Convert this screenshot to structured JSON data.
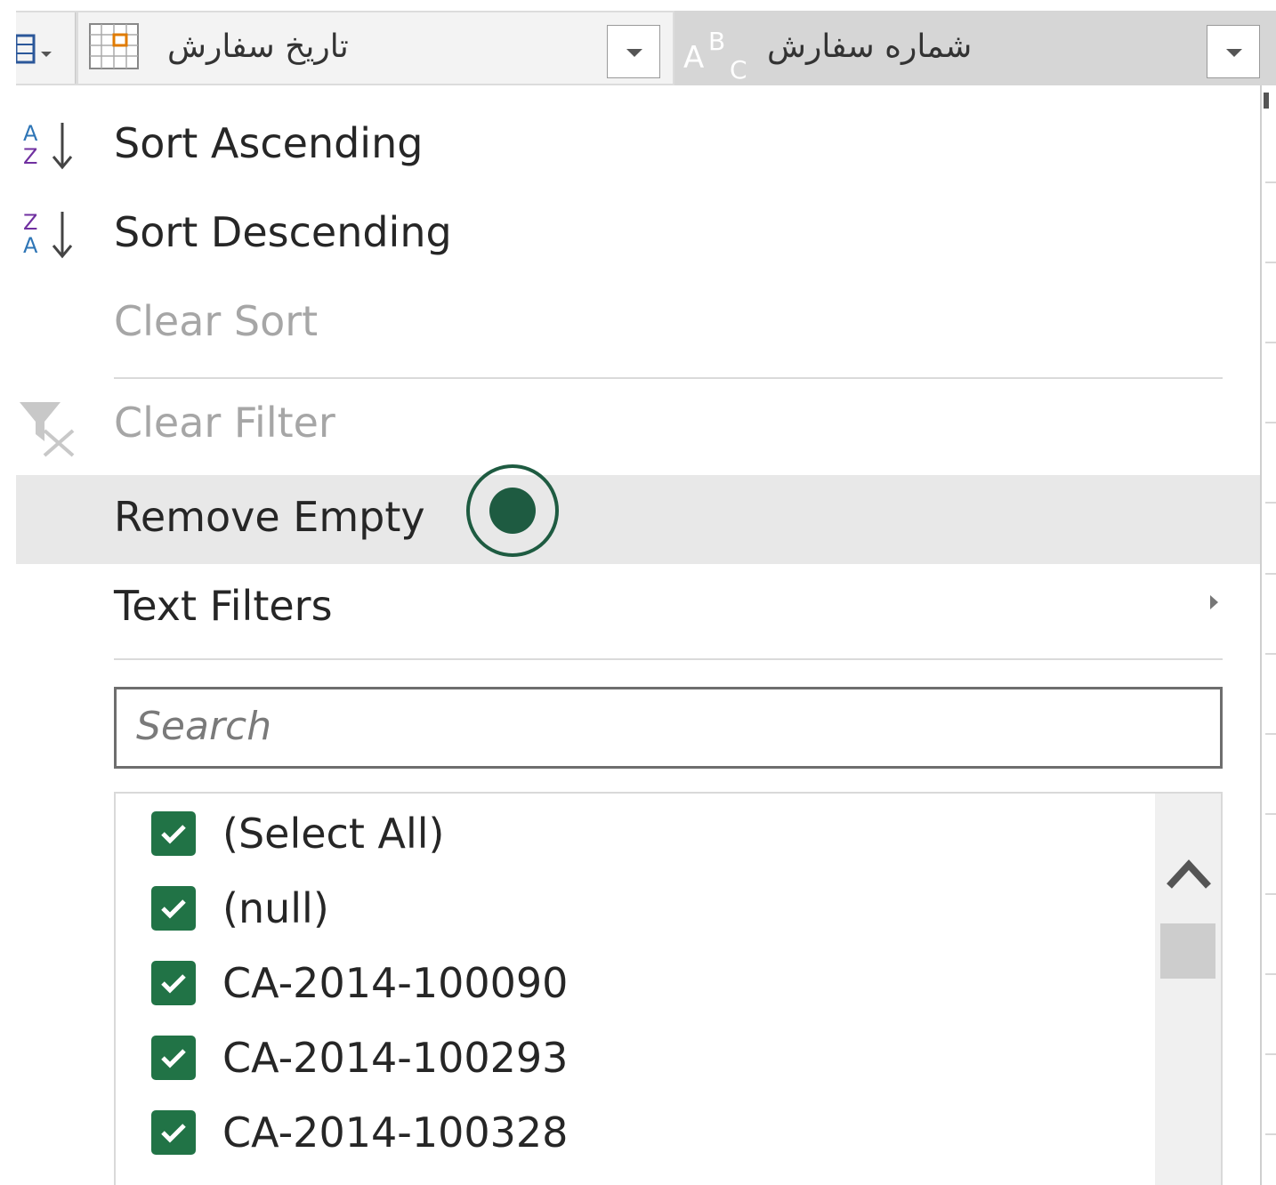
{
  "header": {
    "date_column": {
      "title": "تاریخ سفارش",
      "type_icon": "calendar-table-icon",
      "dropdown_icon": "chevron-down-icon"
    },
    "order_column": {
      "title": "شماره سفارش",
      "type_icon": "text-abc-icon",
      "dropdown_icon": "chevron-down-icon"
    },
    "prev_column": {
      "type_icon": "table-icon"
    }
  },
  "menu": {
    "sort_ascending": "Sort Ascending",
    "sort_descending": "Sort Descending",
    "clear_sort": "Clear Sort",
    "clear_filter": "Clear Filter",
    "remove_empty": "Remove Empty",
    "text_filters": "Text Filters"
  },
  "search": {
    "placeholder": "Search"
  },
  "filter_list": {
    "items": [
      {
        "label": "(Select All)",
        "checked": true
      },
      {
        "label": "(null)",
        "checked": true
      },
      {
        "label": "CA-2014-100090",
        "checked": true
      },
      {
        "label": "CA-2014-100293",
        "checked": true
      },
      {
        "label": "CA-2014-100328",
        "checked": true
      }
    ]
  },
  "colors": {
    "checkbox": "#217346",
    "cursor_marker": "#1e5b41",
    "hover_row": "#e8e8e8"
  }
}
